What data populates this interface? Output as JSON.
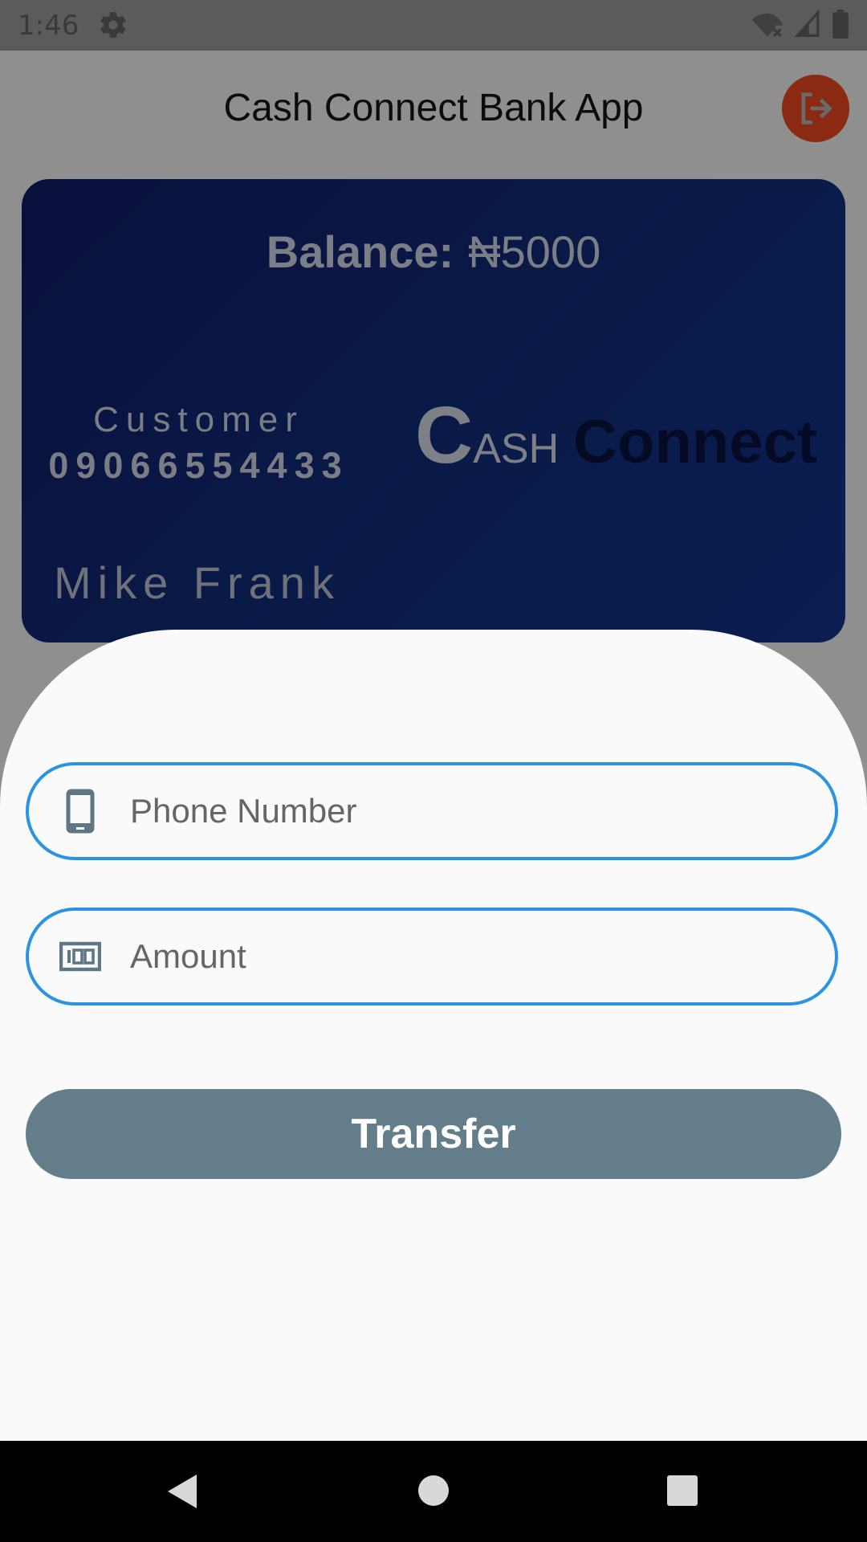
{
  "status_bar": {
    "time": "1:46"
  },
  "app_bar": {
    "title": "Cash Connect Bank App"
  },
  "card": {
    "balance_label": "Balance:",
    "balance_value": "₦5000",
    "customer_label": "Customer",
    "customer_number": "09066554433",
    "logo_c": "C",
    "logo_ash": "ASH",
    "logo_connect": "Connect",
    "holder_name": "Mike Frank"
  },
  "form": {
    "phone_placeholder": "Phone Number",
    "amount_placeholder": "Amount",
    "transfer_label": "Transfer"
  },
  "colors": {
    "field_border": "#2b93e4",
    "transfer_button": "#637d8b",
    "logout_button": "#8a2a12"
  },
  "icons": {
    "settings": "gear-icon",
    "wifi": "wifi-off-icon",
    "signal": "signal-icon",
    "battery": "battery-icon",
    "logout": "logout-icon",
    "phone": "smartphone-icon",
    "amount": "money-icon",
    "back": "nav-back-icon",
    "home": "nav-home-icon",
    "recents": "nav-recents-icon"
  }
}
